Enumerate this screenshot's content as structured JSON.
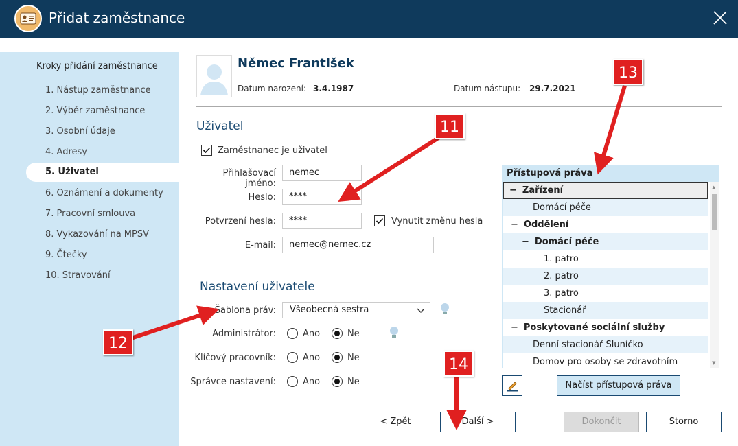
{
  "window": {
    "title": "Přidat zaměstnance"
  },
  "sidebar": {
    "title": "Kroky přidání zaměstnance",
    "steps": [
      "1. Nástup zaměstnance",
      "2. Výběr zaměstnance",
      "3. Osobní údaje",
      "4. Adresy",
      "5. Uživatel",
      "6. Oznámení a dokumenty",
      "7. Pracovní smlouva",
      "8. Vykazování na MPSV",
      "9. Čtečky",
      "10. Stravování"
    ],
    "active_index": 4
  },
  "employee": {
    "name": "Němec František",
    "birth_label": "Datum narození:",
    "birth_value": "3.4.1987",
    "start_label": "Datum nástupu:",
    "start_value": "29.7.2021"
  },
  "user_section": {
    "title": "Uživatel",
    "is_user_label": "Zaměstnanec je uživatel",
    "is_user_checked": true,
    "login_label": "Přihlašovací jméno:",
    "login_value": "nemec",
    "password_label": "Heslo:",
    "password_value": "****",
    "confirm_label": "Potvrzení hesla:",
    "confirm_value": "****",
    "force_change_label": "Vynutit změnu hesla",
    "force_change_checked": true,
    "email_label": "E-mail:",
    "email_value": "nemec@nemec.cz"
  },
  "settings_section": {
    "title": "Nastavení uživatele",
    "template_label": "Šablona práv:",
    "template_value": "Všeobecná sestra",
    "yes": "Ano",
    "no": "Ne",
    "admin_label": "Administrátor:",
    "key_worker_label": "Klíčový pracovník:",
    "settings_admin_label": "Správce nastavení:"
  },
  "access_rights": {
    "header": "Přístupová práva",
    "rows": [
      {
        "text": "Zařízení",
        "expander": "−"
      },
      {
        "text": "Domácí péče",
        "expander": ""
      },
      {
        "text": "Oddělení",
        "expander": "−"
      },
      {
        "text": "Domácí péče",
        "expander": "−"
      },
      {
        "text": "1. patro",
        "expander": ""
      },
      {
        "text": "2. patro",
        "expander": ""
      },
      {
        "text": "3. patro",
        "expander": ""
      },
      {
        "text": "Stacionář",
        "expander": ""
      },
      {
        "text": "Poskytované sociální služby",
        "expander": "−"
      },
      {
        "text": "Denní stacionář Sluníčko",
        "expander": ""
      },
      {
        "text": "Domov pro osoby se zdravotním postiže...",
        "expander": ""
      }
    ],
    "load_button": "Načíst přístupová práva"
  },
  "footer": {
    "back": "< Zpět",
    "next": "Další >",
    "finish": "Dokončit",
    "cancel": "Storno"
  },
  "callouts": [
    "11",
    "12",
    "13",
    "14"
  ],
  "colors": {
    "titlebar": "#0f3a5c",
    "sidebar": "#cfe7f5",
    "callout": "#e02020"
  }
}
